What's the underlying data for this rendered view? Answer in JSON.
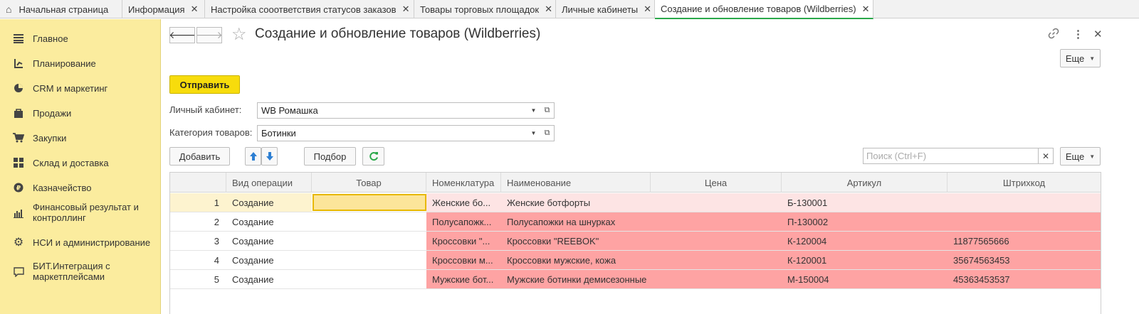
{
  "tabs": [
    {
      "label": "Начальная страница",
      "home": true
    },
    {
      "label": "Информация"
    },
    {
      "label": "Настройка сооответствия статусов заказов"
    },
    {
      "label": "Товары торговых площадок"
    },
    {
      "label": "Личные кабинеты"
    },
    {
      "label": "Создание и обновление товаров (Wildberries)",
      "active": true
    }
  ],
  "sidebar": {
    "items": [
      {
        "label": "Главное",
        "icon": "menu-lines-icon"
      },
      {
        "label": "Планирование",
        "icon": "planning-icon"
      },
      {
        "label": "CRM и маркетинг",
        "icon": "pie-chart-icon"
      },
      {
        "label": "Продажи",
        "icon": "shopping-bag-icon"
      },
      {
        "label": "Закупки",
        "icon": "shopping-cart-icon"
      },
      {
        "label": "Склад и доставка",
        "icon": "warehouse-grid-icon"
      },
      {
        "label": "Казначейство",
        "icon": "ruble-coin-icon"
      },
      {
        "label": "Финансовый результат и\nконтроллинг",
        "icon": "bar-chart-icon"
      },
      {
        "label": "НСИ и администрирование",
        "icon": "gear-icon"
      },
      {
        "label": "БИТ.Интеграция с\nмаркетплейсами",
        "icon": "chat-bubble-icon"
      }
    ]
  },
  "form": {
    "title": "Создание и обновление товаров (Wildberries)",
    "more_label": "Еще",
    "send_label": "Отправить",
    "cabinet_label": "Личный кабинет:",
    "cabinet_value": "WB Ромашка",
    "category_label": "Категория товаров:",
    "category_value": "Ботинки"
  },
  "toolbar": {
    "add_label": "Добавить",
    "pick_label": "Подбор",
    "search_placeholder": "Поиск (Ctrl+F)",
    "more_label": "Еще"
  },
  "table": {
    "columns": [
      "",
      "Вид операции",
      "Товар",
      "Номенклатура",
      "Наименование",
      "Цена",
      "Артикул",
      "Штрихкод"
    ],
    "rows": [
      {
        "n": "1",
        "op": "Создание",
        "item": "",
        "nom": "Женские бо...",
        "name": "Женские ботфорты",
        "price": "",
        "art": "Б-130001",
        "barcode": "",
        "state": "light"
      },
      {
        "n": "2",
        "op": "Создание",
        "item": "",
        "nom": "Полусапожк...",
        "name": "Полусапожки на шнурках",
        "price": "",
        "art": "П-130002",
        "barcode": "",
        "state": "error"
      },
      {
        "n": "3",
        "op": "Создание",
        "item": "",
        "nom": "Кроссовки \"...",
        "name": "Кроссовки \"REEBOK\"",
        "price": "",
        "art": "К-120004",
        "barcode": "11877565666",
        "state": "error"
      },
      {
        "n": "4",
        "op": "Создание",
        "item": "",
        "nom": "Кроссовки м...",
        "name": "Кроссовки мужские, кожа",
        "price": "",
        "art": "К-120001",
        "barcode": "35674563453",
        "state": "error"
      },
      {
        "n": "5",
        "op": "Создание",
        "item": "",
        "nom": "Мужские бот...",
        "name": "Мужские ботинки демисезонные",
        "price": "",
        "art": "М-150004",
        "barcode": "45363453537",
        "state": "error"
      }
    ]
  },
  "colors": {
    "sidebar_bg": "#fbec9e",
    "accent_yellow": "#f7dc0c",
    "error_row": "#fea3a3",
    "error_row_light": "#fde4e4",
    "active_tab_underline": "#2aa84a"
  }
}
